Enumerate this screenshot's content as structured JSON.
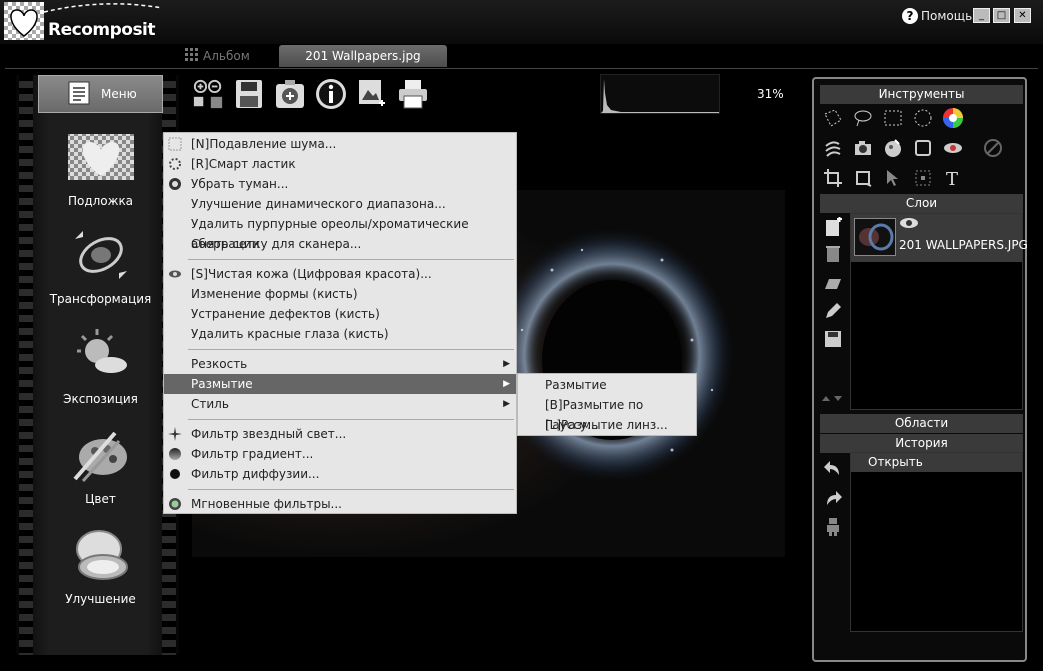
{
  "app": {
    "logo_text": "Recomposit"
  },
  "titlebar": {
    "help_label": "Помощь",
    "minimize": "_",
    "maximize": "□",
    "close": "✕"
  },
  "tabs": {
    "album_label": "Альбом",
    "file_label": "201 Wallpapers.jpg"
  },
  "sidebar": {
    "menu_label": "Меню",
    "items": [
      {
        "label": "Подложка",
        "icon": "heart-backdrop-icon"
      },
      {
        "label": "Трансформация",
        "icon": "transform-icon"
      },
      {
        "label": "Экспозиция",
        "icon": "exposure-icon"
      },
      {
        "label": "Цвет",
        "icon": "color-palette-icon"
      },
      {
        "label": "Улучшение",
        "icon": "compact-mirror-icon"
      }
    ]
  },
  "toolbar": {
    "icons": [
      "zoom-icon",
      "save-icon",
      "add-icon",
      "info-icon",
      "export-image-icon",
      "print-icon"
    ],
    "zoom_level": "31%"
  },
  "context_menu": {
    "items": [
      {
        "label": "[N]Подавление шума...",
        "icon": "noise-icon"
      },
      {
        "label": "[R]Смарт ластик",
        "icon": "eraser-icon"
      },
      {
        "label": "Убрать туман...",
        "icon": "fog-icon"
      },
      {
        "label": "Улучшение динамического диапазона...",
        "icon": ""
      },
      {
        "label": "Удалить пурпурные ореолы/хроматические аберрации",
        "icon": ""
      },
      {
        "label": "Снять сетку для сканера...",
        "icon": ""
      },
      {
        "label": "[S]Чистая кожа (Цифровая красота)...",
        "icon": "eye-icon"
      },
      {
        "label": "Изменение формы (кисть)",
        "icon": ""
      },
      {
        "label": "Устранение дефектов (кисть)",
        "icon": ""
      },
      {
        "label": "Удалить красные глаза (кисть)",
        "icon": ""
      },
      {
        "label": "Резкость",
        "icon": "",
        "submenu": true
      },
      {
        "label": "Размытие",
        "icon": "",
        "submenu": true,
        "highlighted": true
      },
      {
        "label": "Стиль",
        "icon": "",
        "submenu": true
      },
      {
        "label": "Фильтр звездный свет...",
        "icon": "star-icon"
      },
      {
        "label": "Фильтр градиент...",
        "icon": "gradient-icon"
      },
      {
        "label": "Фильтр диффузии...",
        "icon": "diffusion-icon"
      },
      {
        "label": "Мгновенные фильтры...",
        "icon": "instant-filter-icon"
      }
    ],
    "submenu": [
      {
        "label": "Размытие"
      },
      {
        "label": "[B]Размытие по Гауссу..."
      },
      {
        "label": "[L]Размытие линз..."
      }
    ]
  },
  "right_panel": {
    "tools_header": "Инструменты",
    "layers_header": "Слои",
    "layer_name": "201 WALLPAPERS.JPG",
    "regions_header": "Области",
    "history_header": "История",
    "history_item": "Открыть"
  },
  "colors": {
    "highlight": "#666666",
    "menu_bg": "#e6e6e6",
    "panel_header": "#3a3a3a"
  }
}
